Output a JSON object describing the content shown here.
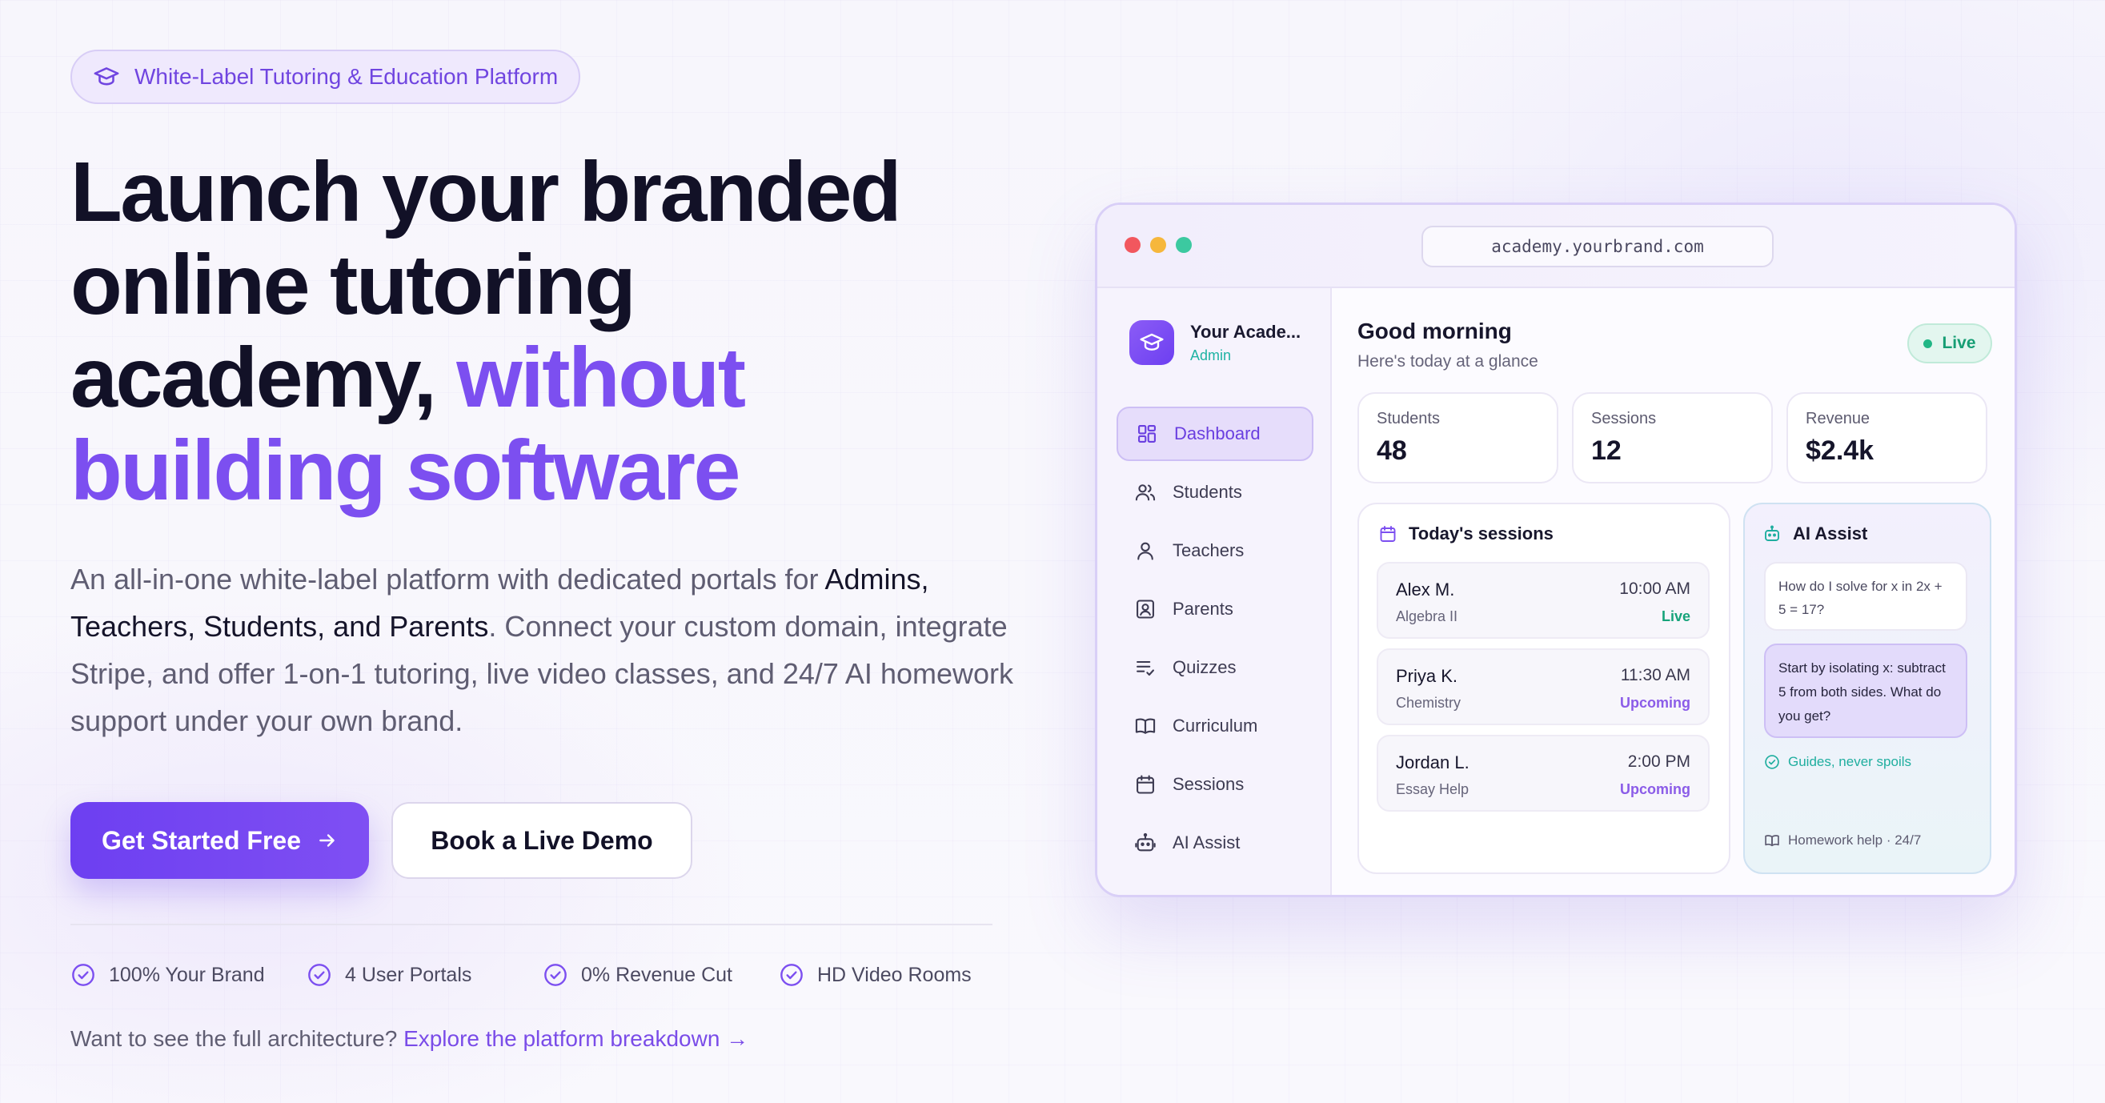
{
  "hero": {
    "badge": "White-Label Tutoring & Education Platform",
    "headline_line1": "Launch your branded",
    "headline_line2": "online tutoring",
    "headline_line3_dark": "academy, ",
    "headline_line3_accent": "without",
    "headline_line4_accent": "building software",
    "lede_part1": "An all-in-one white-label platform with dedicated portals for ",
    "lede_strong": "Admins, Teachers, Students, and Parents",
    "lede_part2": ". Connect your custom domain, integrate Stripe, and offer 1-on-1 tutoring, live video classes, and 24/7 AI homework support under your own brand.",
    "primary_cta": "Get Started Free",
    "secondary_cta": "Book a Live Demo",
    "features": [
      "100% Your Brand",
      "4 User Portals",
      "0% Revenue Cut",
      "HD Video Rooms"
    ],
    "explore_prefix": "Want to see the full architecture? ",
    "explore_link": "Explore the platform breakdown →"
  },
  "mockup": {
    "url": "academy.yourbrand.com",
    "brand_name": "Your Acade...",
    "brand_role": "Admin",
    "nav": [
      {
        "label": "Dashboard",
        "icon": "dashboard-icon",
        "active": true
      },
      {
        "label": "Students",
        "icon": "users-icon"
      },
      {
        "label": "Teachers",
        "icon": "user-icon"
      },
      {
        "label": "Parents",
        "icon": "portrait-icon"
      },
      {
        "label": "Quizzes",
        "icon": "checklist-icon"
      },
      {
        "label": "Curriculum",
        "icon": "book-icon"
      },
      {
        "label": "Sessions",
        "icon": "calendar-icon"
      },
      {
        "label": "AI Assist",
        "icon": "bot-icon"
      }
    ],
    "greeting": "Good morning",
    "greeting_sub": "Here's today at a glance",
    "live_label": "Live",
    "stats": [
      {
        "label": "Students",
        "value": "48"
      },
      {
        "label": "Sessions",
        "value": "12"
      },
      {
        "label": "Revenue",
        "value": "$2.4k"
      }
    ],
    "sessions_title": "Today's sessions",
    "sessions": [
      {
        "name": "Alex M.",
        "subject": "Algebra II",
        "time": "10:00 AM",
        "status": "Live"
      },
      {
        "name": "Priya K.",
        "subject": "Chemistry",
        "time": "11:30 AM",
        "status": "Upcoming"
      },
      {
        "name": "Jordan L.",
        "subject": "Essay Help",
        "time": "2:00 PM",
        "status": "Upcoming"
      }
    ],
    "ai_title": "AI Assist",
    "ai_question": "How do I solve for x in 2x + 5 = 17?",
    "ai_answer": "Start by isolating x: subtract 5 from both sides. What do you get?",
    "ai_guides": "Guides, never spoils",
    "ai_footer": "Homework help · 24/7"
  },
  "colors": {
    "accent": "#7c4ff0",
    "live_green": "#16a37a",
    "teal": "#1fae9f"
  }
}
